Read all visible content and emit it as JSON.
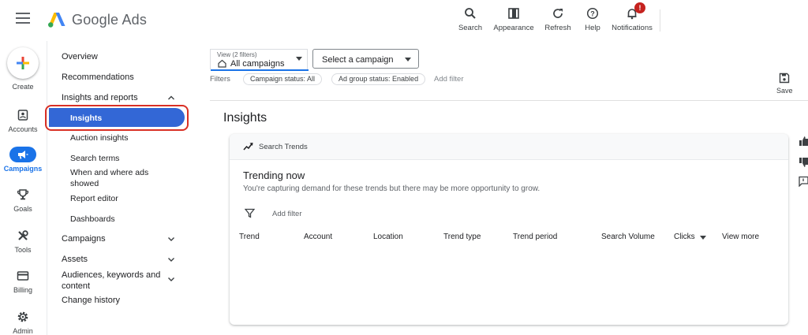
{
  "header": {
    "brand": "Google Ads",
    "tools": [
      {
        "label": "Search",
        "icon": "search-icon"
      },
      {
        "label": "Appearance",
        "icon": "appearance-icon"
      },
      {
        "label": "Refresh",
        "icon": "refresh-icon"
      },
      {
        "label": "Help",
        "icon": "help-icon"
      },
      {
        "label": "Notifications",
        "icon": "bell-icon",
        "badge": "!"
      }
    ]
  },
  "rail": {
    "create": "Create",
    "items": [
      {
        "label": "Accounts",
        "icon": "accounts-icon"
      },
      {
        "label": "Campaigns",
        "icon": "campaigns-icon",
        "active": true
      },
      {
        "label": "Goals",
        "icon": "trophy-icon"
      },
      {
        "label": "Tools",
        "icon": "tools-icon"
      },
      {
        "label": "Billing",
        "icon": "credit-card-icon"
      },
      {
        "label": "Admin",
        "icon": "gear-icon"
      }
    ]
  },
  "nav": {
    "overview": "Overview",
    "recommendations": "Recommendations",
    "insights_reports": "Insights and reports",
    "insights": "Insights",
    "auction_insights": "Auction insights",
    "search_terms": "Search terms",
    "when_where_1": "When and where ads",
    "when_where_2": "showed",
    "report_editor": "Report editor",
    "dashboards": "Dashboards",
    "campaigns": "Campaigns",
    "assets": "Assets",
    "audiences_1": "Audiences, keywords and",
    "audiences_2": "content",
    "change_history": "Change history"
  },
  "toolbar": {
    "view_caption": "View (2 filters)",
    "view_value": "All campaigns",
    "campaign_select": "Select a campaign",
    "filters_label": "Filters",
    "chips": [
      "Campaign status: All",
      "Ad group status: Enabled"
    ],
    "add_filter": "Add filter",
    "save": "Save"
  },
  "page": {
    "title": "Insights"
  },
  "card": {
    "header": "Search Trends",
    "title": "Trending now",
    "subtitle": "You're capturing demand for these trends but there may be more opportunity to grow.",
    "add_filter": "Add filter",
    "columns": [
      "Trend",
      "Account",
      "Location",
      "Trend type",
      "Trend period",
      "Search Volume",
      "Clicks",
      "View more"
    ]
  },
  "colors": {
    "accent": "#1a73e8",
    "selected": "#3367d6",
    "highlight_outline": "#d93025",
    "badge": "#c5221f"
  }
}
